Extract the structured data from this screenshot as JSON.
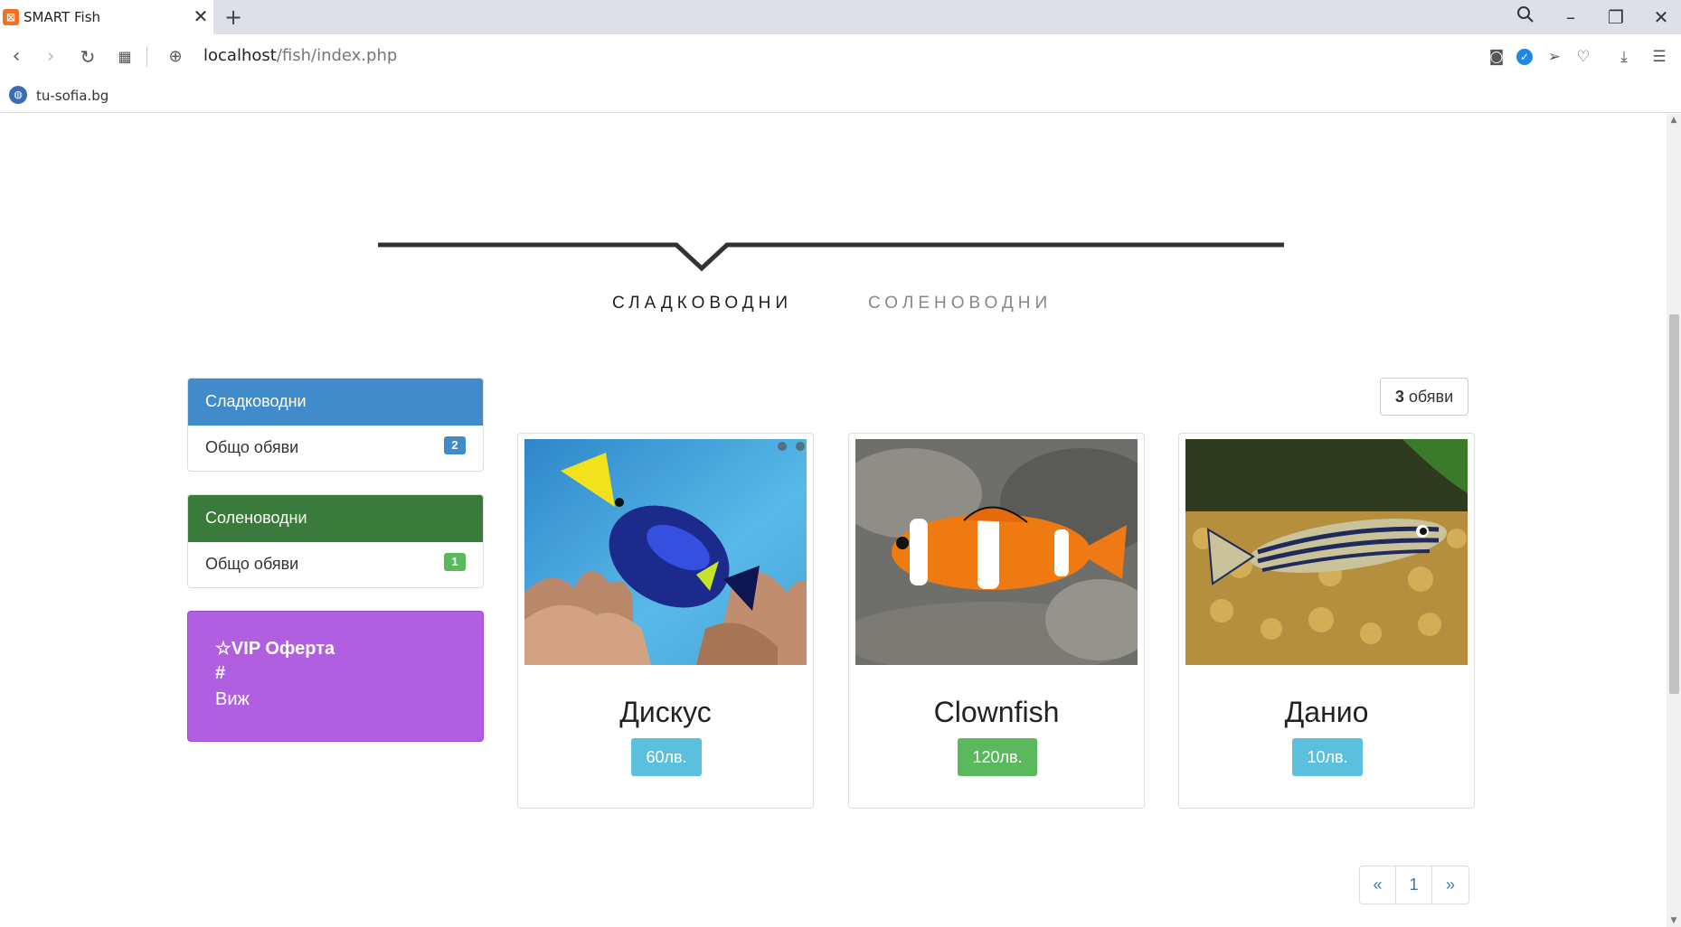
{
  "browser": {
    "tab_title": "SMART Fish",
    "tab_favicon": "xampp-icon",
    "url_host": "localhost",
    "url_path": "/fish/index.php",
    "bookmark_label": "tu-sofia.bg"
  },
  "filters": {
    "freshwater": "СЛАДКОВОДНИ",
    "saltwater": "СОЛЕНОВОДНИ"
  },
  "sidebar": {
    "freshwater_panel": {
      "heading": "Сладководни",
      "label": "Общо обяви",
      "count": "2",
      "color": "#428bca"
    },
    "saltwater_panel": {
      "heading": "Соленоводни",
      "label": "Общо обяви",
      "count": "1",
      "color": "#3a7a3a"
    },
    "vip": {
      "title": "☆VIP Оферта",
      "hash": "#",
      "link": "Виж",
      "color": "#b05fe0"
    }
  },
  "listing": {
    "count_number": "3",
    "count_label": "обяви",
    "cards": [
      {
        "name": "Дискус",
        "price": "60лв.",
        "price_color": "#5bc0de"
      },
      {
        "name": "Clownfish",
        "price": "120лв.",
        "price_color": "#5cb85c"
      },
      {
        "name": "Данио",
        "price": "10лв.",
        "price_color": "#5bc0de"
      }
    ]
  },
  "pagination": {
    "prev": "«",
    "page": "1",
    "next": "»"
  }
}
